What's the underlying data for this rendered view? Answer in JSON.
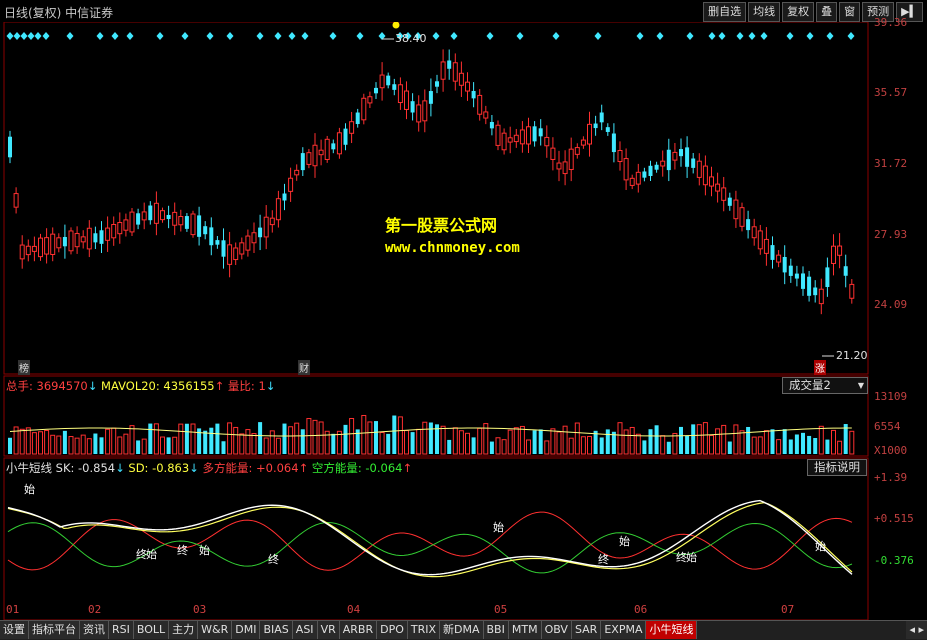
{
  "topbar": {
    "title": "日线(复权)  中信证券",
    "buttons": [
      "删自选",
      "均线",
      "复权",
      "叠",
      "窗",
      "预测"
    ]
  },
  "price_axis": {
    "labels": [
      "39.36",
      "35.57",
      "31.72",
      "27.93",
      "24.09"
    ]
  },
  "annotations": {
    "high": "38.40",
    "low": "21.20",
    "marker_left": "榜",
    "marker_mid": "财",
    "marker_right": "涨"
  },
  "watermark": {
    "line1": "第一股票公式网",
    "line2": "www.chnmoney.com"
  },
  "volume_bar": {
    "total_label": "总手: ",
    "total_value": "3694570",
    "mavol_label": "MAVOL20: ",
    "mavol_value": "4356155",
    "ratio_label": "量比: ",
    "ratio_value": "1",
    "selector": "成交量2",
    "axis": [
      "13109",
      "6554",
      "X1000"
    ]
  },
  "indicator_bar": {
    "name": "小牛短线",
    "sk_label": "SK: ",
    "sk_value": "-0.854",
    "sd_label": "SD: ",
    "sd_value": "-0.863",
    "long_label": "多方能量: ",
    "long_value": "+0.064",
    "short_label": "空方能量: ",
    "short_value": "-0.064",
    "help_button": "指标说明",
    "axis": [
      "+1.39",
      "+0.515",
      "-0.376"
    ]
  },
  "signals": {
    "start": "始",
    "end": "终"
  },
  "months": [
    "01",
    "02",
    "03",
    "04",
    "05",
    "06",
    "07"
  ],
  "tabs": [
    "设置",
    "指标平台",
    "资讯",
    "RSI",
    "BOLL",
    "主力",
    "W&R",
    "DMI",
    "BIAS",
    "ASI",
    "VR",
    "ARBR",
    "DPO",
    "TRIX",
    "新DMA",
    "BBI",
    "MTM",
    "OBV",
    "SAR",
    "EXPMA",
    "小牛短线"
  ],
  "active_tab": "小牛短线",
  "colors": {
    "up": "#ff3030",
    "down": "#40e8ff",
    "ma": "#ffff80",
    "sk": "#ffffff",
    "long": "#ff3030",
    "short": "#33cc33"
  }
}
